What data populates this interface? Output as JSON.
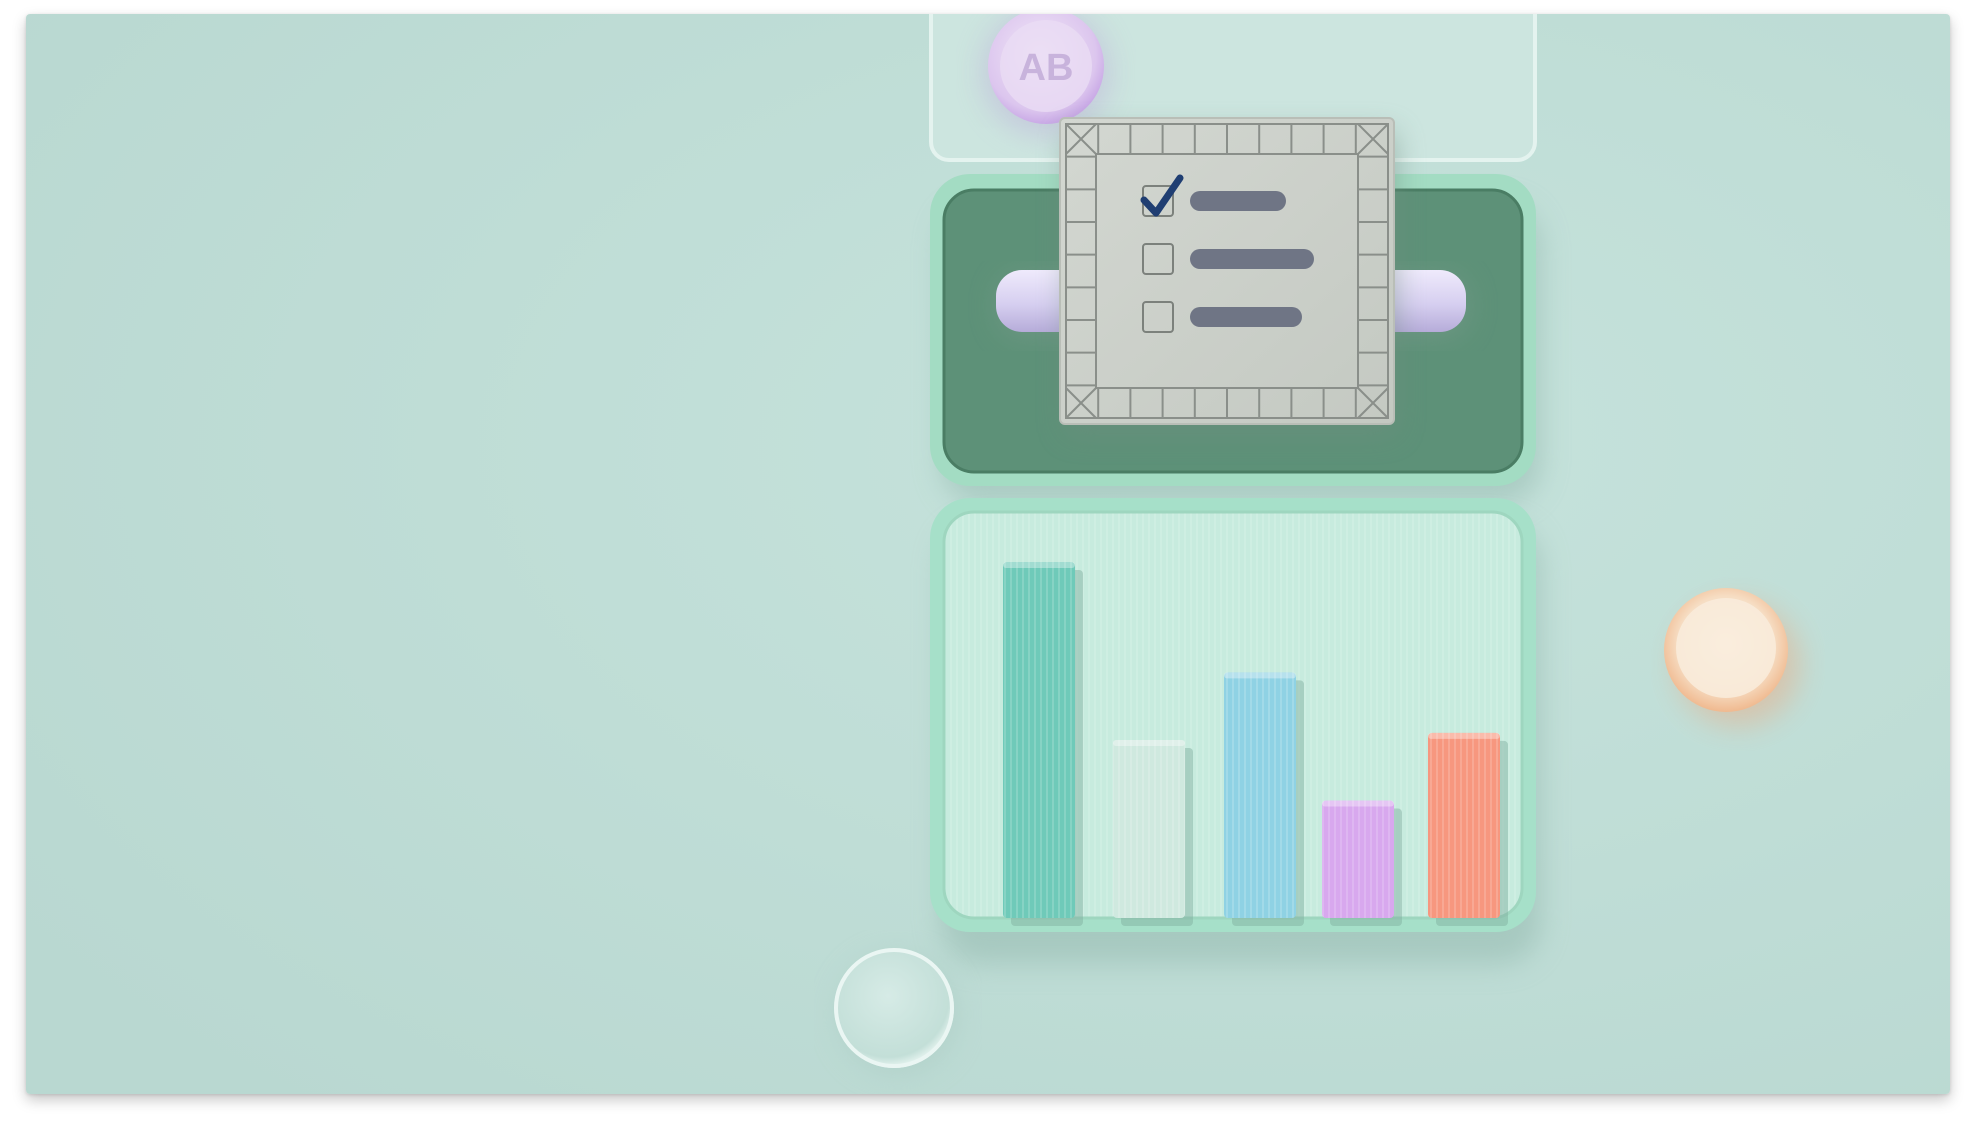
{
  "scene": {
    "badge_text": "AB",
    "colors": {
      "background": "#bfdcd5",
      "tray_rim": "#9fd9bf",
      "tray_felt": "#5a8f73",
      "lower_tray_inner": "#c9ece0",
      "card": "#c9cec8",
      "card_lines": "#6f7585",
      "check": "#1f3e72",
      "roller": "#d9d4ef",
      "badge": "#e7d7f2",
      "cup": "#f5d8bd"
    },
    "checklist_items": [
      {
        "checked": true
      },
      {
        "checked": false
      },
      {
        "checked": false
      }
    ],
    "bars": [
      {
        "color": "#6fcab9",
        "level": 1.0
      },
      {
        "color": "#cfe9df",
        "level": 0.5
      },
      {
        "color": "#8fd2e4",
        "level": 0.69
      },
      {
        "color": "#d8a8ee",
        "level": 0.33
      },
      {
        "color": "#f7977f",
        "level": 0.52
      }
    ]
  }
}
